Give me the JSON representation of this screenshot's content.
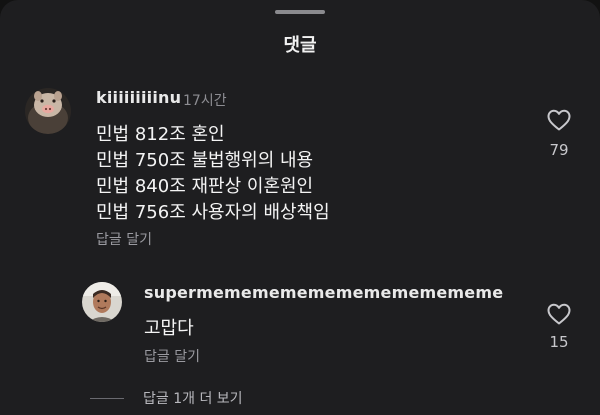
{
  "sheet": {
    "title": "댓글"
  },
  "comments": [
    {
      "username": "kiiiiiiiiinu",
      "time": "17시간",
      "lines": [
        "민법 812조 혼인",
        "민법 750조 불법행위의 내용",
        "민법 840조 재판상 이혼원인",
        "민법 756조 사용자의 배상책임"
      ],
      "reply_label": "답글 달기",
      "likes": "79",
      "like_icon": "heart-outline-icon"
    },
    {
      "username": "supermememememememememememe",
      "time": "",
      "lines": [
        "고맙다"
      ],
      "reply_label": "답글 달기",
      "likes": "15",
      "like_icon": "heart-outline-icon"
    }
  ],
  "more_replies_label": "답글 1개 더 보기",
  "colors": {
    "background": "#1e1e20",
    "primary_text": "#f4f4f4",
    "secondary_text": "#8d8d92",
    "icon": "#c8c8cc"
  }
}
